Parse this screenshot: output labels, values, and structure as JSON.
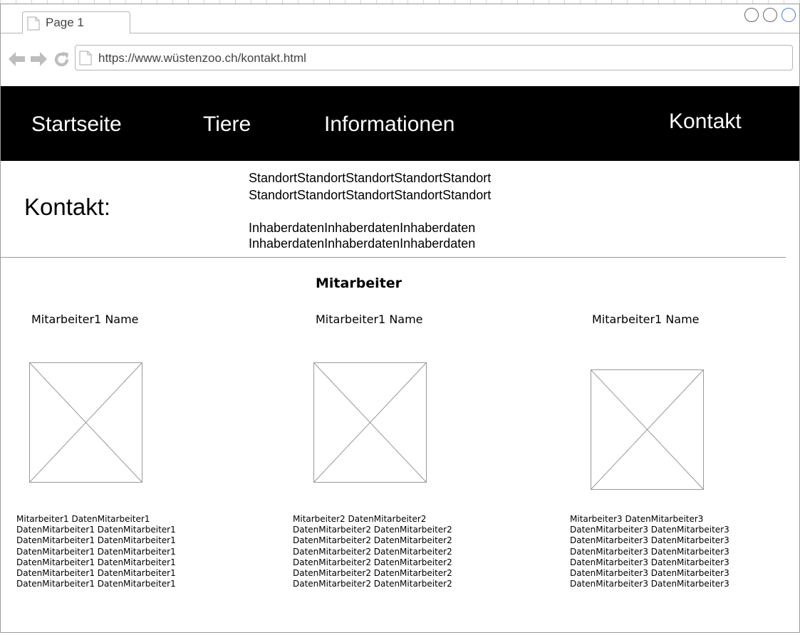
{
  "browser": {
    "tab_label": "Page 1",
    "url": "https://www.wüstenzoo.ch/kontakt.html"
  },
  "nav": {
    "items": [
      "Startseite",
      "Tiere",
      "Informationen",
      "Kontakt"
    ]
  },
  "contact": {
    "title": "Kontakt:",
    "location_lines": [
      "StandortStandortStandortStandortStandort",
      "StandortStandortStandortStandortStandort"
    ],
    "owner_lines": [
      "InhaberdatenInhaberdatenInhaberdaten",
      "InhaberdatenInhaberdatenInhaberdaten"
    ]
  },
  "staff": {
    "heading": "Mitarbeiter",
    "members": [
      {
        "name": "Mitarbeiter1 Name",
        "data_lines": [
          "Mitarbeiter1 DatenMitarbeiter1",
          "DatenMitarbeiter1 DatenMitarbeiter1",
          "DatenMitarbeiter1 DatenMitarbeiter1",
          "DatenMitarbeiter1 DatenMitarbeiter1",
          "DatenMitarbeiter1 DatenMitarbeiter1",
          "DatenMitarbeiter1 DatenMitarbeiter1",
          "DatenMitarbeiter1 DatenMitarbeiter1"
        ]
      },
      {
        "name": "Mitarbeiter1 Name",
        "data_lines": [
          "Mitarbeiter2 DatenMitarbeiter2",
          "DatenMitarbeiter2 DatenMitarbeiter2",
          "DatenMitarbeiter2 DatenMitarbeiter2",
          "DatenMitarbeiter2 DatenMitarbeiter2",
          "DatenMitarbeiter2 DatenMitarbeiter2",
          "DatenMitarbeiter2 DatenMitarbeiter2",
          "DatenMitarbeiter2 DatenMitarbeiter2"
        ]
      },
      {
        "name": "Mitarbeiter1 Name",
        "data_lines": [
          "Mitarbeiter3 DatenMitarbeiter3",
          "DatenMitarbeiter3 DatenMitarbeiter3",
          "DatenMitarbeiter3 DatenMitarbeiter3",
          "DatenMitarbeiter3 DatenMitarbeiter3",
          "DatenMitarbeiter3 DatenMitarbeiter3",
          "DatenMitarbeiter3 DatenMitarbeiter3",
          "DatenMitarbeiter3 DatenMitarbeiter3"
        ]
      }
    ]
  }
}
